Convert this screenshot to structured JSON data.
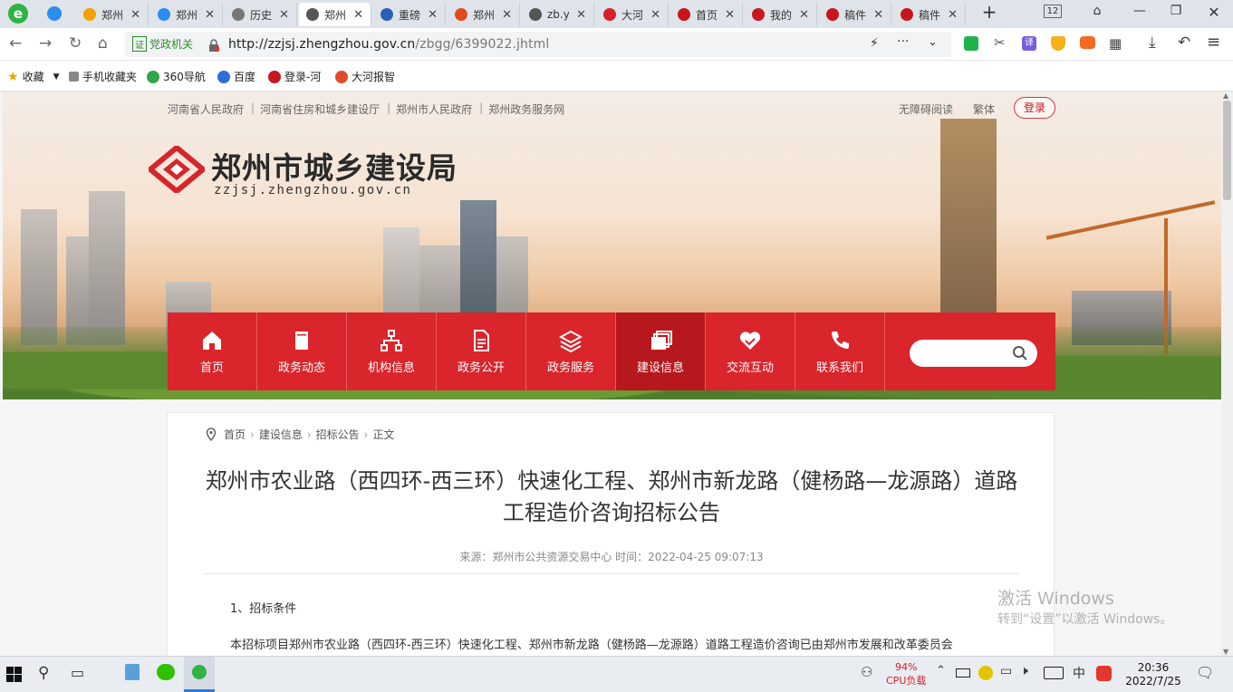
{
  "browser": {
    "tabs": [
      {
        "label": "郑州",
        "color": "#f2a100"
      },
      {
        "label": "郑州",
        "color": "#2d8cf0"
      },
      {
        "label": "历史",
        "color": "#777777"
      },
      {
        "label": "郑州",
        "color": "#555555"
      },
      {
        "label": "重磅",
        "color": "#2b5fb7"
      },
      {
        "label": "郑州",
        "color": "#e24a1f"
      },
      {
        "label": "zb.y",
        "color": "#555555"
      },
      {
        "label": "大河",
        "color": "#d8202a"
      },
      {
        "label": "首页",
        "color": "#c8161d"
      },
      {
        "label": "我的",
        "color": "#c8161d"
      },
      {
        "label": "稿件",
        "color": "#c8161d"
      },
      {
        "label": "稿件",
        "color": "#c8161d"
      }
    ],
    "new_tab": "+",
    "tab_count": "12",
    "gov_badge": "党政机关",
    "gov_badge_mark": "证",
    "url_host": "http://zzjsj.zhengzhou.gov.cn",
    "url_path": "/zbgg/6399022.jhtml",
    "bookmarks": [
      "收藏",
      "手机收藏夹",
      "360导航",
      "百度",
      "登录-河",
      "大河报智"
    ]
  },
  "site": {
    "top_links": [
      "河南省人民政府",
      "河南省住房和城乡建设厅",
      "郑州市人民政府",
      "郑州政务服务网"
    ],
    "accessibility": "无障碍阅读",
    "traditional": "繁体",
    "login": "登录",
    "name": "郑州市城乡建设局",
    "domain": "zzjsj.zhengzhou.gov.cn",
    "nav": [
      {
        "label": "首页",
        "icon": "home-icon"
      },
      {
        "label": "政务动态",
        "icon": "book-icon"
      },
      {
        "label": "机构信息",
        "icon": "org-chart-icon"
      },
      {
        "label": "政务公开",
        "icon": "document-icon"
      },
      {
        "label": "政务服务",
        "icon": "layers-icon"
      },
      {
        "label": "建设信息",
        "icon": "stack-icon",
        "active": true
      },
      {
        "label": "交流互动",
        "icon": "handshake-icon"
      },
      {
        "label": "联系我们",
        "icon": "phone-icon"
      }
    ],
    "search_placeholder": ""
  },
  "article": {
    "breadcrumb": [
      "首页",
      "建设信息",
      "招标公告",
      "正文"
    ],
    "title": "郑州市农业路（西四环-西三环）快速化工程、郑州市新龙路（健杨路—龙源路）道路工程造价咨询招标公告",
    "meta": "来源：郑州市公共资源交易中心  时间：2022-04-25 09:07:13",
    "section1": "1、招标条件",
    "paragraph1": "本招标项目郑州市农业路（西四环-西三环）快速化工程、郑州市新龙路（健杨路—龙源路）道路工程造价咨询已由郑州市发展和改革委员会"
  },
  "watermark": {
    "line1": "激活 Windows",
    "line2": "转到“设置”以激活 Windows。"
  },
  "taskbar": {
    "cpu_percent": "94%",
    "cpu_label": "CPU负载",
    "ime": "中",
    "time": "20:36",
    "date": "2022/7/25"
  }
}
